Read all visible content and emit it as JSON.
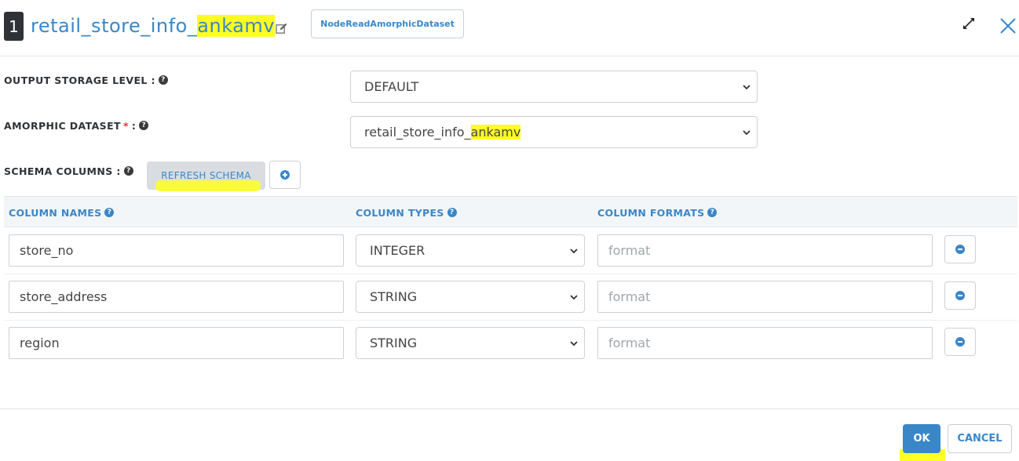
{
  "header": {
    "node_number": "1",
    "title_prefix": "retail_store_info_",
    "title_highlight": "ankamv",
    "node_type": "NodeReadAmorphicDataset"
  },
  "form": {
    "output_storage_label": "OUTPUT STORAGE LEVEL :",
    "output_storage_value": "DEFAULT",
    "dataset_label": "AMORPHIC DATASET",
    "dataset_required": "*",
    "dataset_colon": ":",
    "dataset_value_prefix": "retail_store_info_",
    "dataset_value_highlight": "ankamv",
    "schema_label": "SCHEMA COLUMNS :",
    "refresh_label": "REFRESH SCHEMA"
  },
  "table": {
    "headers": {
      "names": "COLUMN NAMES",
      "types": "COLUMN TYPES",
      "formats": "COLUMN FORMATS"
    },
    "rows": [
      {
        "name": "store_no",
        "type": "INTEGER",
        "format_placeholder": "format"
      },
      {
        "name": "store_address",
        "type": "STRING",
        "format_placeholder": "format"
      },
      {
        "name": "region",
        "type": "STRING",
        "format_placeholder": "format"
      }
    ]
  },
  "footer": {
    "ok": "OK",
    "cancel": "CANCEL"
  },
  "colors": {
    "accent": "#3a87c8",
    "highlight": "#ffff24",
    "badge": "#2f3337"
  },
  "icons": [
    "edit-icon",
    "expand-icon",
    "close-icon",
    "help-icon",
    "add-circle-icon",
    "remove-circle-icon",
    "chevron-down-icon"
  ]
}
